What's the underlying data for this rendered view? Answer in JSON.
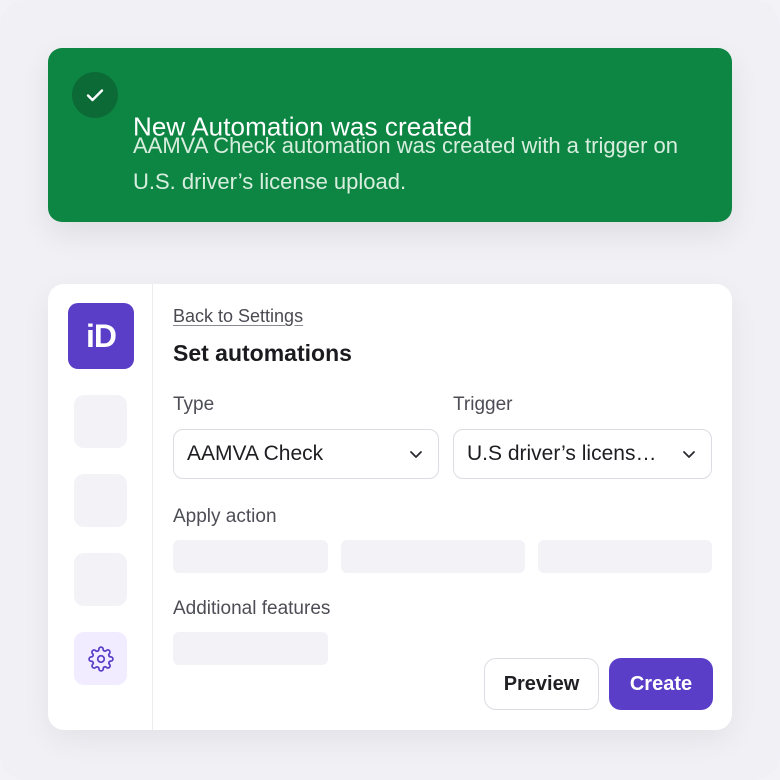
{
  "toast": {
    "title": "New Automation was created",
    "message": "AAMVA Check automation was created with a trigger on U.S. driver’s license upload.",
    "color": "#0e8643",
    "icon": "check-icon"
  },
  "sidebar": {
    "logo_text": "iD",
    "logo_color": "#5b3ec8",
    "settings_icon": "gear-icon"
  },
  "main": {
    "back_link": "Back to Settings",
    "title": "Set automations",
    "type": {
      "label": "Type",
      "value": "AAMVA Check"
    },
    "trigger": {
      "label": "Trigger",
      "value": "U.S driver’s licens…"
    },
    "apply_action_label": "Apply action",
    "additional_features_label": "Additional features",
    "preview_button": "Preview",
    "create_button": "Create",
    "accent_color": "#5b3ec8"
  }
}
